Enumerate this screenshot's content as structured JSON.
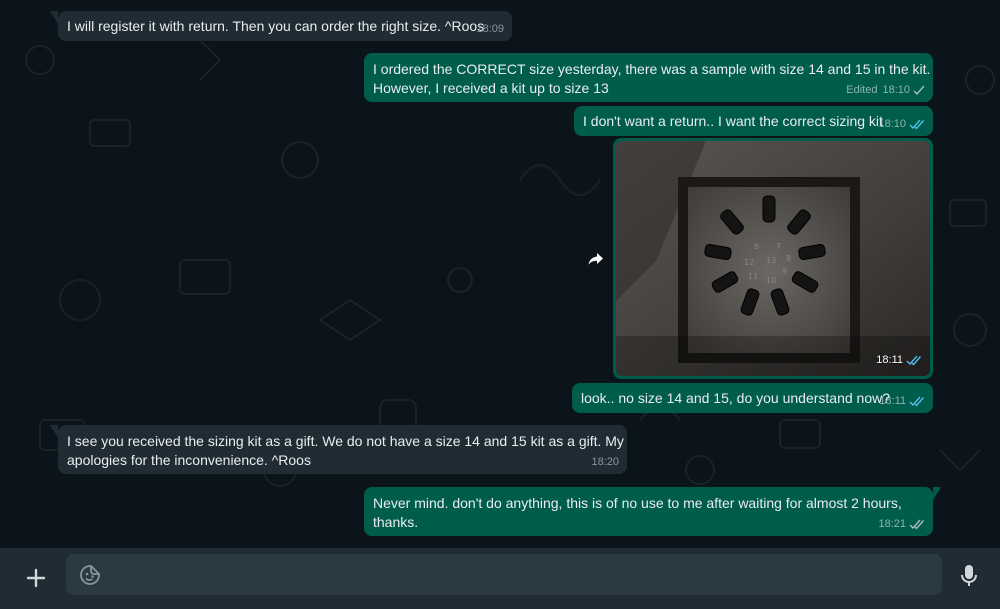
{
  "colors": {
    "chat_background": "#0b141a",
    "incoming_bubble": "#202c33",
    "outgoing_bubble": "#005c4b",
    "read_tick": "#53bdeb",
    "footer": "#202c33",
    "composer": "#2a3942"
  },
  "messages": [
    {
      "direction": "incoming",
      "text": "I will register it with return. Then you can order the right size. ^Roos",
      "time": "18:09"
    },
    {
      "direction": "outgoing",
      "line1": "I ordered the CORRECT size yesterday, there was a sample with size 14 and 15 in the kit.",
      "line2": "However, I received a kit up to size 13",
      "edited_label": "Edited",
      "time": "18:10",
      "status": "sent"
    },
    {
      "direction": "outgoing",
      "text": "I don't want a return.. I want the correct sizing kit",
      "time": "18:10",
      "status": "read"
    },
    {
      "direction": "outgoing",
      "type": "image",
      "image_description": "sizing-kit-photo",
      "ring_labels": [
        "6",
        "7",
        "8",
        "9",
        "10",
        "11",
        "12",
        "13"
      ],
      "time": "18:11",
      "status": "read"
    },
    {
      "direction": "outgoing",
      "text": "look.. no size 14 and 15, do you understand now?",
      "time": "18:11",
      "status": "read"
    },
    {
      "direction": "incoming",
      "line1": "I see you received the sizing kit as a gift. We do not have a size 14 and 15 kit as a gift. My",
      "line2": "apologies for the inconvenience. ^Roos",
      "time": "18:20"
    },
    {
      "direction": "outgoing",
      "line1": "Never mind. don't do anything, this is of no use to me after waiting for almost 2 hours,",
      "line2": "thanks.",
      "time": "18:21",
      "status": "sent"
    }
  ],
  "icons": {
    "forward": "forward-icon",
    "attach": "plus-icon",
    "emoji": "sticker-emoji-icon",
    "voice": "microphone-icon"
  },
  "composer": {
    "placeholder": "",
    "value": ""
  }
}
